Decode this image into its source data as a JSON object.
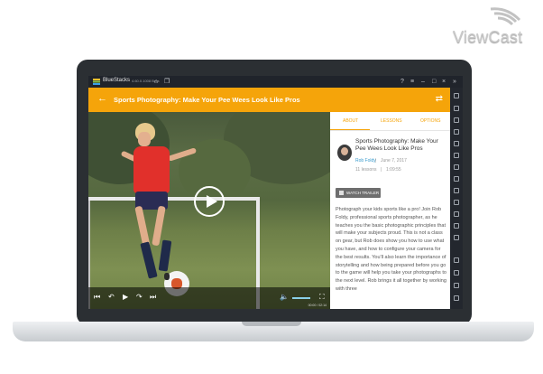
{
  "logo": {
    "text": "ViewCast"
  },
  "bluestacks": {
    "title": "BlueStacks",
    "version": "4.60.0.1008 Beta"
  },
  "header": {
    "title": "Sports Photography: Make Your Pee Wees Look Like Pros",
    "accent_color": "#f5a40a"
  },
  "player": {
    "time": "00:00 / 02:14"
  },
  "tabs": [
    {
      "label": "ABOUT",
      "active": true
    },
    {
      "label": "LESSONS",
      "active": false
    },
    {
      "label": "OPTIONS",
      "active": false
    }
  ],
  "course": {
    "title": "Sports Photography: Make Your Pee Wees Look Like Pros",
    "author": "Rob Foldy",
    "separator": "|",
    "date": "June 7, 2017",
    "lessons": "11 lessons",
    "duration": "1:09:55",
    "trailer_label": "WATCH TRAILER",
    "description": "Photograph your kids sports like a pro! Join Rob Foldy, professional sports photographer, as he teaches you the basic photographic principles that will make your subjects proud. This is not a class on gear, but Rob does show you how to use what you have, and how to configure your camera for the best results. You'll also learn the importance of storytelling and how being prepared before you go to the game will help you take your photographs to the next level. Rob brings it all together by working with three"
  }
}
